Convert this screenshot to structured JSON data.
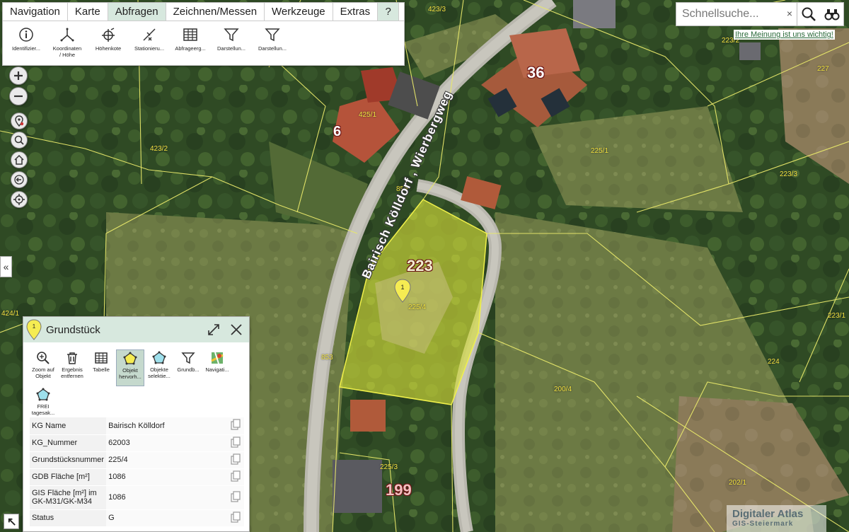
{
  "menu": {
    "tabs": [
      {
        "label": "Navigation"
      },
      {
        "label": "Karte"
      },
      {
        "label": "Abfragen"
      },
      {
        "label": "Zeichnen/Messen"
      },
      {
        "label": "Werkzeuge"
      },
      {
        "label": "Extras"
      },
      {
        "label": "?"
      }
    ],
    "active_tab": "Abfragen",
    "tools": [
      {
        "label": "Identifizier...",
        "icon": "info-icon"
      },
      {
        "label": "Koordinaten\n/ Höhe",
        "icon": "coordinates-icon"
      },
      {
        "label": "Höhenkote",
        "icon": "elevation-point-icon"
      },
      {
        "label": "Stationieru...",
        "icon": "stationing-icon"
      },
      {
        "label": "Abfrageerg...",
        "icon": "table-icon"
      },
      {
        "label": "Darstellun...",
        "icon": "filter-icon"
      },
      {
        "label": "Darstellun...",
        "icon": "filter-icon"
      }
    ]
  },
  "search": {
    "placeholder": "Schnellsuche...",
    "clear_label": "×"
  },
  "feedback_link": "Ihre Meinung ist uns wichtig!",
  "map": {
    "street_label": "Bairisch Kölldorf , Wierbergweg",
    "house_numbers": [
      "36",
      "6",
      "223",
      "199"
    ],
    "parcel_labels": [
      "423/3",
      "223/2",
      "227",
      "425/1",
      "423/2",
      "225/1",
      "223/3",
      "856",
      "225/4",
      "223/1",
      "424/1",
      "853",
      "224",
      "200/4",
      "225/3",
      "202/1",
      "227"
    ],
    "marker_number": "1",
    "collapse_label": "«"
  },
  "panel": {
    "title": "Grundstück",
    "marker_number": "1",
    "tools": [
      {
        "label": "Zoom auf\nObjekt",
        "icon": "zoom-to-object-icon"
      },
      {
        "label": "Ergebnis\nentfernen",
        "icon": "trash-icon"
      },
      {
        "label": "Tabelle",
        "icon": "table-icon"
      },
      {
        "label": "Objekt\nhervorh...",
        "icon": "highlight-polygon-icon",
        "active": true
      },
      {
        "label": "Objekte\nselektie...",
        "icon": "select-polygon-icon"
      },
      {
        "label": "Grundb...",
        "icon": "filter-icon"
      },
      {
        "label": "Navigati...",
        "icon": "navigation-icon"
      },
      {
        "label": "FREI\ntagesak...",
        "icon": "frei-polygon-icon"
      }
    ],
    "attributes": [
      {
        "key": "KG Name",
        "value": "Bairisch Kölldorf"
      },
      {
        "key": "KG_Nummer",
        "value": "62003"
      },
      {
        "key": "Grundstücksnummer",
        "value": "225/4"
      },
      {
        "key": "GDB Fläche [m²]",
        "value": "1086"
      },
      {
        "key": "GIS Fläche [m²] im GK-M31/GK-M34",
        "value": "1086"
      },
      {
        "key": "Status",
        "value": "G"
      }
    ]
  },
  "logo": {
    "line1": "Digitaler Atlas",
    "line2": "GIS-Steiermark"
  },
  "colors": {
    "tab_active": "#d7e8de",
    "parcel_highlight": "#d8e03a",
    "parcel_lines": "#e8e86a"
  }
}
